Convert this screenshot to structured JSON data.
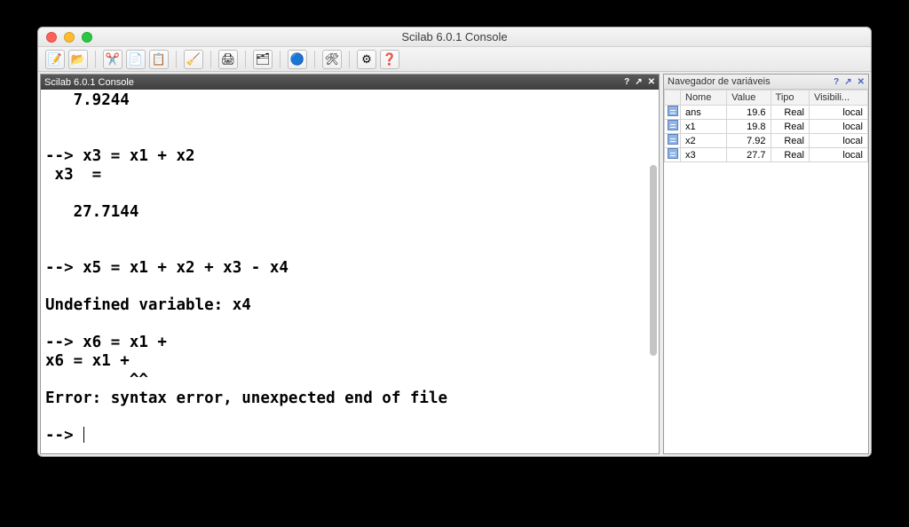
{
  "window": {
    "title": "Scilab 6.0.1 Console"
  },
  "console_panel": {
    "title": "Scilab 6.0.1 Console",
    "lines": {
      "l0": "   7.9244",
      "l1": "",
      "l2": "",
      "l3": "--> x3 = x1 + x2",
      "l4": " x3  = ",
      "l5": "",
      "l6": "   27.7144",
      "l7": "",
      "l8": "",
      "l9": "--> x5 = x1 + x2 + x3 - x4",
      "l10": "",
      "l11": "Undefined variable: x4",
      "l12": "",
      "l13": "--> x6 = x1 +",
      "l14": "x6 = x1 +",
      "l15": "         ^^",
      "l16": "Error: syntax error, unexpected end of file",
      "l17": "",
      "prompt": "--> "
    }
  },
  "var_panel": {
    "title": "Navegador de variáveis",
    "headers": {
      "name": "Nome",
      "value": "Value",
      "type": "Tipo",
      "vis": "Visibili..."
    },
    "rows": [
      {
        "name": "ans",
        "value": "19.6",
        "type": "Real",
        "vis": "local"
      },
      {
        "name": "x1",
        "value": "19.8",
        "type": "Real",
        "vis": "local"
      },
      {
        "name": "x2",
        "value": "7.92",
        "type": "Real",
        "vis": "local"
      },
      {
        "name": "x3",
        "value": "27.7",
        "type": "Real",
        "vis": "local"
      }
    ]
  },
  "toolbar_icons": {
    "edit": "📝",
    "open": "📂",
    "cut": "✂️",
    "copy": "📄",
    "paste": "📋",
    "clear": "🧹",
    "print": "🖨",
    "folder": "🗂",
    "panel": "🔵",
    "tools": "🛠",
    "gear": "⚙",
    "help": "❓"
  }
}
